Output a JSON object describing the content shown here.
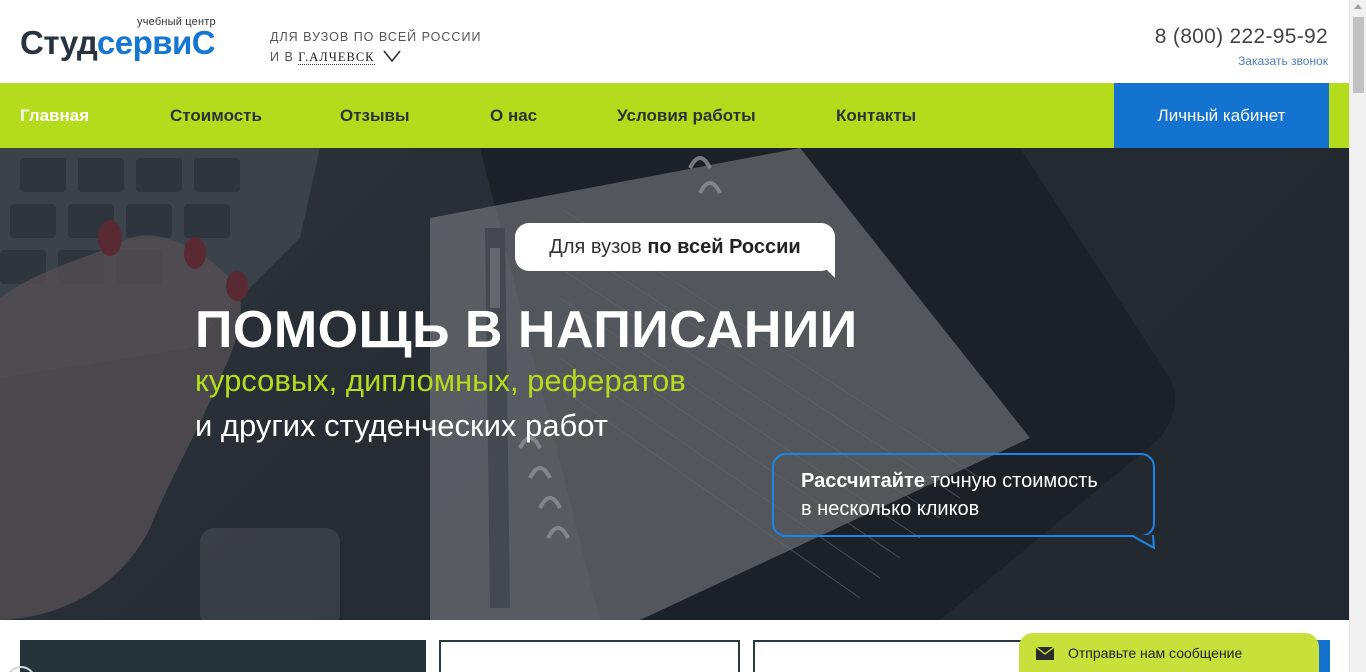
{
  "header": {
    "logo_sub": "учебный центр",
    "logo_part1": "Студ",
    "logo_part2": "сервиС",
    "region_line1": "ДЛЯ ВУЗОВ ПО ВСЕЙ РОССИИ",
    "region_prefix": "И В",
    "city": "Г.АЛЧЕВСК",
    "phone": "8 (800) 222-95-92",
    "callback": "Заказать звонок"
  },
  "nav": {
    "items": [
      {
        "label": "Главная"
      },
      {
        "label": "Стоимость"
      },
      {
        "label": "Отзывы"
      },
      {
        "label": "О нас"
      },
      {
        "label": "Условия работы"
      },
      {
        "label": "Контакты"
      }
    ],
    "cabinet": "Личный кабинет"
  },
  "hero": {
    "bubble_normal": "Для вузов ",
    "bubble_bold": "по всей России",
    "title": "ПОМОЩЬ В НАПИСАНИИ",
    "subtitle1": "курсовых, дипломных, рефератов",
    "subtitle2": "и других студенческих работ",
    "calc_bold": "Рассчитайте",
    "calc_rest1": " точную стоимость",
    "calc_rest2": "в несколько кликов"
  },
  "chat": {
    "label": "Отправьте нам сообщение"
  },
  "colors": {
    "accent_green": "#b5db1d",
    "accent_blue": "#1473cf",
    "dark": "#2d3438"
  }
}
